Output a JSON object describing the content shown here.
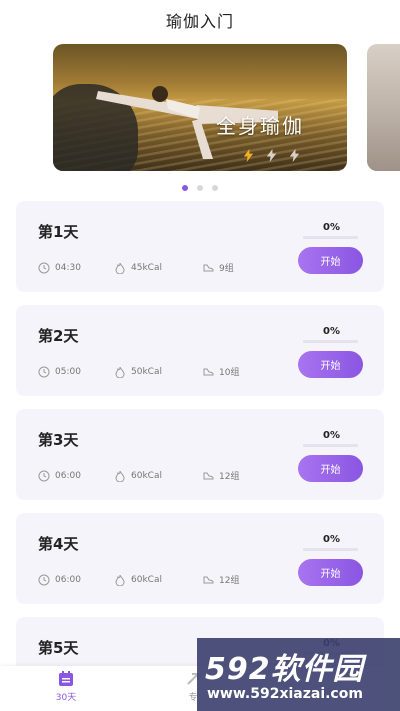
{
  "header": {
    "title": "瑜伽入门"
  },
  "banner": {
    "title": "全身瑜伽",
    "bolt_icons": [
      "bolt-active-icon",
      "bolt-icon",
      "bolt-icon"
    ]
  },
  "carousel": {
    "active_index": 0,
    "count": 3
  },
  "days": [
    {
      "title": "第1天",
      "duration": "04:30",
      "calories": "45kCal",
      "groups": "9组",
      "progress": "0%",
      "progress_value": 0,
      "button": "开始"
    },
    {
      "title": "第2天",
      "duration": "05:00",
      "calories": "50kCal",
      "groups": "10组",
      "progress": "0%",
      "progress_value": 0,
      "button": "开始"
    },
    {
      "title": "第3天",
      "duration": "06:00",
      "calories": "60kCal",
      "groups": "12组",
      "progress": "0%",
      "progress_value": 0,
      "button": "开始"
    },
    {
      "title": "第4天",
      "duration": "06:00",
      "calories": "60kCal",
      "groups": "12组",
      "progress": "0%",
      "progress_value": 0,
      "button": "开始"
    },
    {
      "title": "第5天",
      "progress": "0%",
      "progress_value": 0
    }
  ],
  "tabbar": {
    "items": [
      {
        "label": "30天",
        "icon": "calendar-icon",
        "active": true
      },
      {
        "label": "专",
        "icon": "arrow-icon",
        "active": false
      }
    ]
  },
  "watermark": {
    "big": "592软件园",
    "small": "www.592xiazai.com"
  },
  "colors": {
    "accent": "#8a56e2",
    "card_bg": "#f5f4fa"
  }
}
